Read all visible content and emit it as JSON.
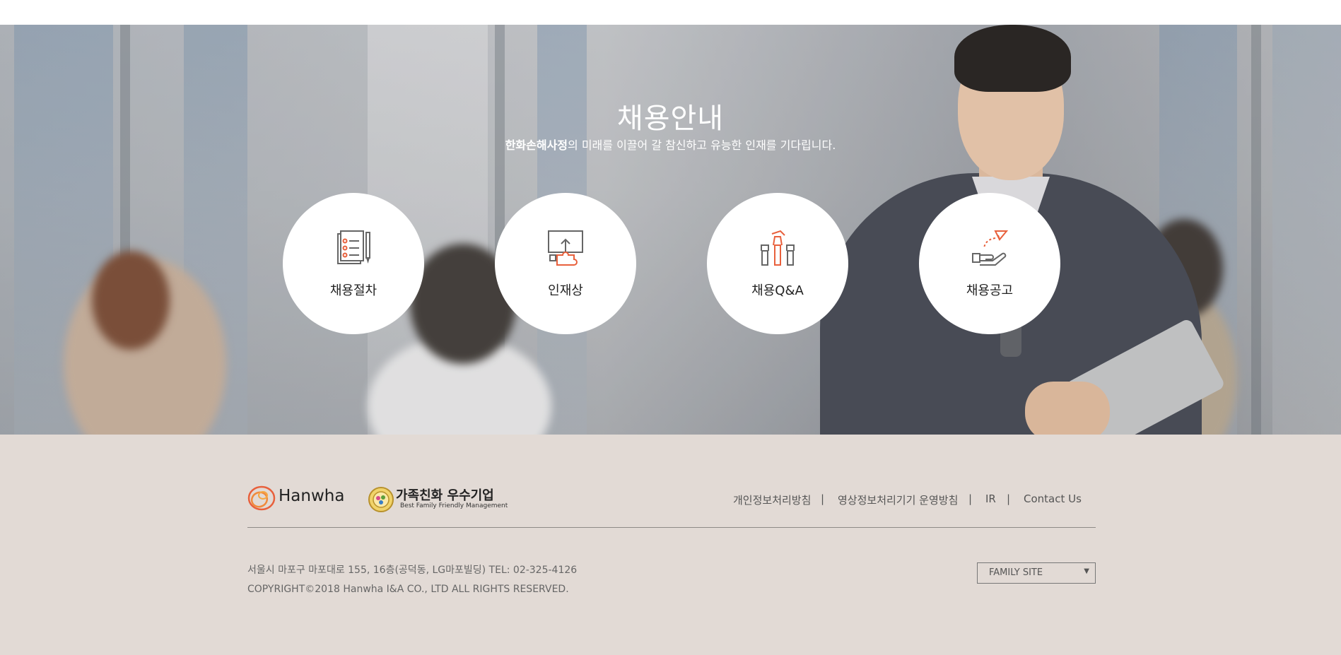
{
  "hero": {
    "title": "채용안내",
    "subtitle_bold": "한화손해사정",
    "subtitle_rest": "의 미래를 이끌어 갈 참신하고 유능한 인재를 기다립니다.",
    "menu": [
      {
        "label": "채용절차",
        "icon": "document-checklist-icon"
      },
      {
        "label": "인재상",
        "icon": "puzzle-icon"
      },
      {
        "label": "채용Q&A",
        "icon": "raised-hands-icon"
      },
      {
        "label": "채용공고",
        "icon": "hand-paper-plane-icon"
      }
    ]
  },
  "footer": {
    "logo_text": "Hanwha",
    "family_logo_kr": "가족친화 우수기업",
    "family_logo_en": "Best Family Friendly Management",
    "links": [
      "개인정보처리방침",
      "영상정보처리기기 운영방침",
      "IR",
      "Contact Us"
    ],
    "separator": "|",
    "address": "서울시 마포구 마포대로 155, 16층(공덕동, LG마포빌딩) TEL: 02-325-4126",
    "copyright": "COPYRIGHT©2018 Hanwha I&A CO., LTD ALL RIGHTS RESERVED.",
    "family_site": {
      "selected": "FAMILY SITE",
      "arrow": "▼"
    }
  },
  "colors": {
    "accent": "#e8603c",
    "footer_bg": "#e2dad5",
    "icon_gray": "#666666"
  }
}
